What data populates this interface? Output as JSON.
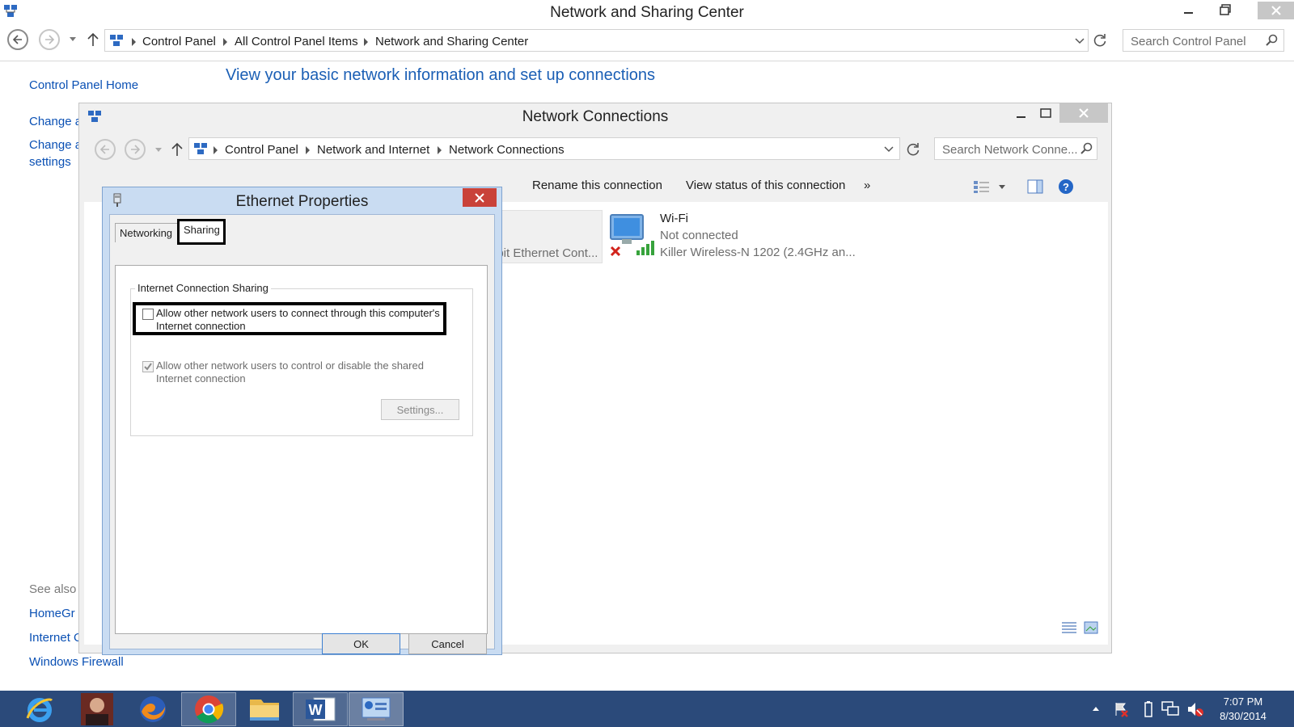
{
  "main_window": {
    "title": "Network and Sharing Center",
    "breadcrumb": [
      "Control Panel",
      "All Control Panel Items",
      "Network and Sharing Center"
    ],
    "search_placeholder": "Search Control Panel",
    "heading": "View your basic network information and set up connections",
    "sidebar": {
      "home": "Control Panel Home",
      "change_adapter": "Change a",
      "change_advanced_line1": "Change a",
      "change_advanced_line2": "settings",
      "see_also": "See also",
      "homegroup": "HomeGr",
      "internet_options": "Internet O",
      "windows_firewall": "Windows Firewall"
    }
  },
  "network_connections": {
    "title": "Network Connections",
    "breadcrumb": [
      "Control Panel",
      "Network and Internet",
      "Network Connections"
    ],
    "search_placeholder": "Search Network Conne...",
    "toolbar": {
      "rename": "Rename this connection",
      "view_status": "View status of this connection",
      "more": "»"
    },
    "ethernet_partial_label": "abit Ethernet Cont...",
    "wifi": {
      "name": "Wi-Fi",
      "status": "Not connected",
      "device": "Killer Wireless-N 1202 (2.4GHz an..."
    }
  },
  "ethernet_properties": {
    "title": "Ethernet Properties",
    "tabs": [
      "Networking",
      "Sharing"
    ],
    "active_tab": "Sharing",
    "group_title": "Internet Connection Sharing",
    "option_allow_connect": {
      "label": "Allow other network users to connect through this computer's Internet connection",
      "checked": false
    },
    "option_allow_control": {
      "label": "Allow other network users to control or disable the shared Internet connection",
      "checked": true,
      "disabled": true
    },
    "settings_button": "Settings...",
    "ok_button": "OK",
    "cancel_button": "Cancel"
  },
  "taskbar": {
    "apps": [
      "internet-explorer-icon",
      "user-photo-icon",
      "firefox-icon",
      "chrome-icon",
      "file-explorer-icon",
      "word-icon",
      "control-panel-icon"
    ],
    "time": "7:07 PM",
    "date": "8/30/2014"
  },
  "colors": {
    "link": "#0a50b4",
    "taskbar": "#2b4a7a",
    "dialog_frame": "#c9dcf2",
    "close_red": "#c9423a"
  }
}
